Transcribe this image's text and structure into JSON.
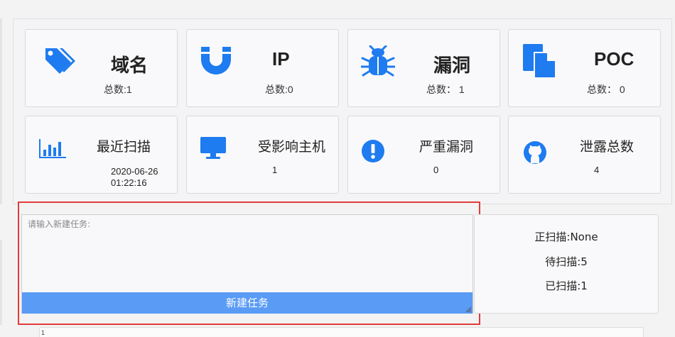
{
  "cards_top": [
    {
      "title": "域名",
      "count": "总数:1",
      "icon": "tags-icon"
    },
    {
      "title": "IP",
      "count": "总数:0",
      "icon": "magnet-icon"
    },
    {
      "title": "漏洞",
      "count": "总数： 1",
      "icon": "bug-icon"
    },
    {
      "title": "POC",
      "count": "总数： 0",
      "icon": "copy-icon"
    }
  ],
  "cards_bottom": [
    {
      "title": "最近扫描",
      "value_line1": "2020-06-26",
      "value_line2": "01:22:16",
      "icon": "bar-chart-icon"
    },
    {
      "title": "受影响主机",
      "value": "1",
      "icon": "desktop-icon"
    },
    {
      "title": "严重漏洞",
      "value": "0",
      "icon": "exclamation-circle-icon"
    },
    {
      "title": "泄露总数",
      "value": "4",
      "icon": "github-icon"
    }
  ],
  "task": {
    "placeholder": "请输入新建任务:",
    "button_label": "新建任务"
  },
  "status": {
    "scanning": "正扫描:None",
    "pending": "待扫描:5",
    "scanned": "已扫描:1"
  },
  "bottom_editor": {
    "line_number": "1"
  },
  "colors": {
    "accent": "#1e7bf0",
    "button": "#599bf5",
    "highlight_border": "#e23b3b"
  }
}
